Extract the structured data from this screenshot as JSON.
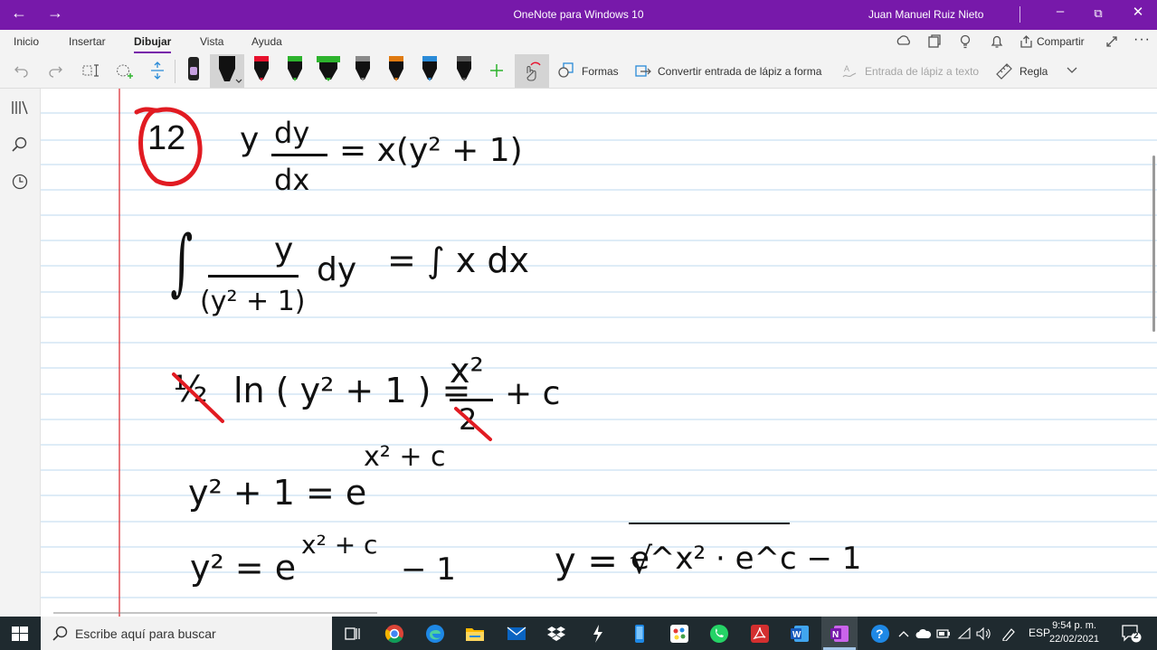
{
  "window": {
    "title": "OneNote para Windows 10",
    "user": "Juan Manuel Ruiz Nieto",
    "back": "←",
    "forward": "→",
    "minimize": "–",
    "restore": "⧉",
    "close": "✕"
  },
  "menu": {
    "items": [
      "Inicio",
      "Insertar",
      "Dibujar",
      "Vista",
      "Ayuda"
    ],
    "active": "Dibujar",
    "share_label": "Compartir"
  },
  "toolbar": {
    "shapes_label": "Formas",
    "convert_label": "Convertir entrada de lápiz a forma",
    "ink_to_text_label": "Entrada de lápiz a texto",
    "ruler_label": "Regla",
    "pens": [
      {
        "color": "#111111",
        "type": "marker"
      },
      {
        "color": "#111111",
        "type": "pen-selected"
      },
      {
        "color": "#e8112d",
        "type": "pen"
      },
      {
        "color": "#2db32d",
        "type": "pen"
      },
      {
        "color": "#2db32d",
        "type": "highlighter"
      },
      {
        "color": "#8a8a8a",
        "type": "pencil"
      },
      {
        "color": "#e07a10",
        "type": "galaxy"
      },
      {
        "color": "#2a8bd8",
        "type": "pen"
      },
      {
        "color": "#444444",
        "type": "pencil"
      }
    ]
  },
  "ink": {
    "problem_number": "12",
    "line1_lhs": "y",
    "line1_dy": "dy",
    "line1_dx": "dx",
    "line1_rhs": "= x(y² + 1)",
    "line2_num": "y",
    "line2_den": "(y² + 1)",
    "line2_dy": "dy",
    "line2_rhs": "= ∫ x dx",
    "line3_half": "½",
    "line3_lhs": "ln ( y² + 1 ) =",
    "line3_xsq": "x²",
    "line3_two": "2",
    "line3_c": "+ c",
    "line4_lhs": "y² + 1  = e",
    "line4_exp": "x² + c",
    "line5_lhs": "y² = e",
    "line5_exp": "x² + c",
    "line5_minus": "− 1",
    "line5_right": "y = √",
    "line5_root": "e^x² · e^c − 1",
    "ink_color": "#111111",
    "accent_color": "#e11b22"
  },
  "taskbar": {
    "search_placeholder": "Escribe aquí para buscar",
    "lang": "ESP",
    "time": "9:54 p. m.",
    "date": "22/02/2021",
    "notifications": "2"
  }
}
